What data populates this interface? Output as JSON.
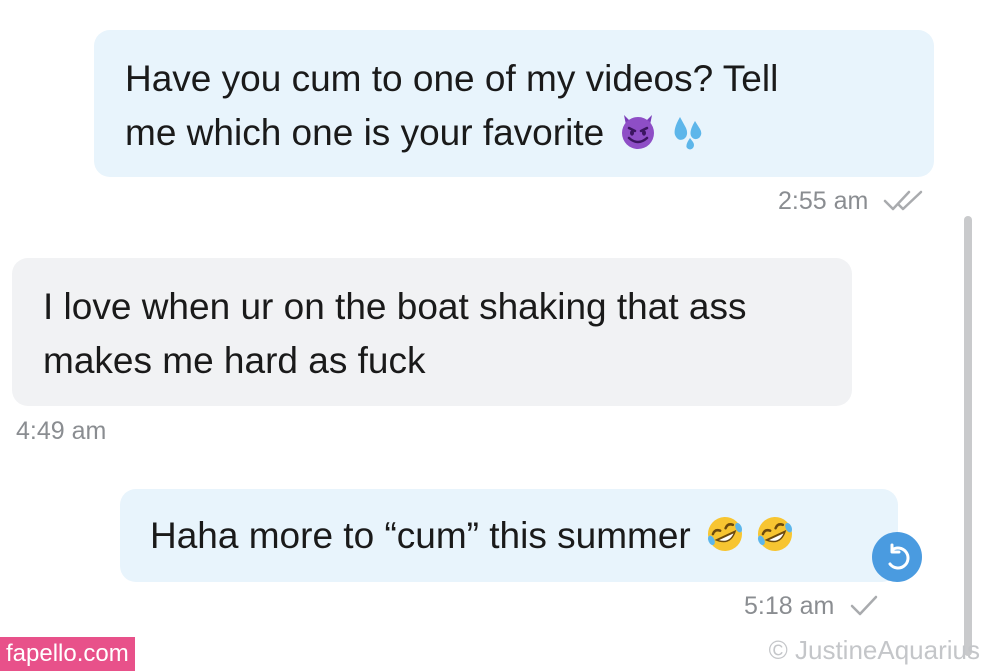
{
  "messages": [
    {
      "direction": "outgoing",
      "line1": "Have you cum to one of my videos? Tell",
      "line2": "me which one is your favorite",
      "emojis": [
        "smiling-imp-emoji",
        "sweat-droplets-emoji"
      ],
      "time": "2:55 am",
      "status": "read"
    },
    {
      "direction": "incoming",
      "line1": "I love when ur on the boat shaking that ass",
      "line2": "makes me hard as fuck",
      "time": "4:49 am"
    },
    {
      "direction": "outgoing",
      "line1": "Haha more to “cum” this summer",
      "emojis": [
        "rolling-on-floor-laughing-emoji",
        "rolling-on-floor-laughing-emoji"
      ],
      "time": "5:18 am",
      "status": "sent"
    }
  ],
  "icons": {
    "reply": "reply-arrow-icon",
    "read": "double-check-icon",
    "sent": "single-check-icon"
  },
  "watermarks": {
    "site": "fapello.com",
    "copyright": "©  JustineAquarius"
  },
  "colors": {
    "outgoing_bubble": "#e8f4fc",
    "incoming_bubble": "#f1f2f4",
    "reply_button": "#4a9be0",
    "site_watermark": "#e8518a"
  }
}
